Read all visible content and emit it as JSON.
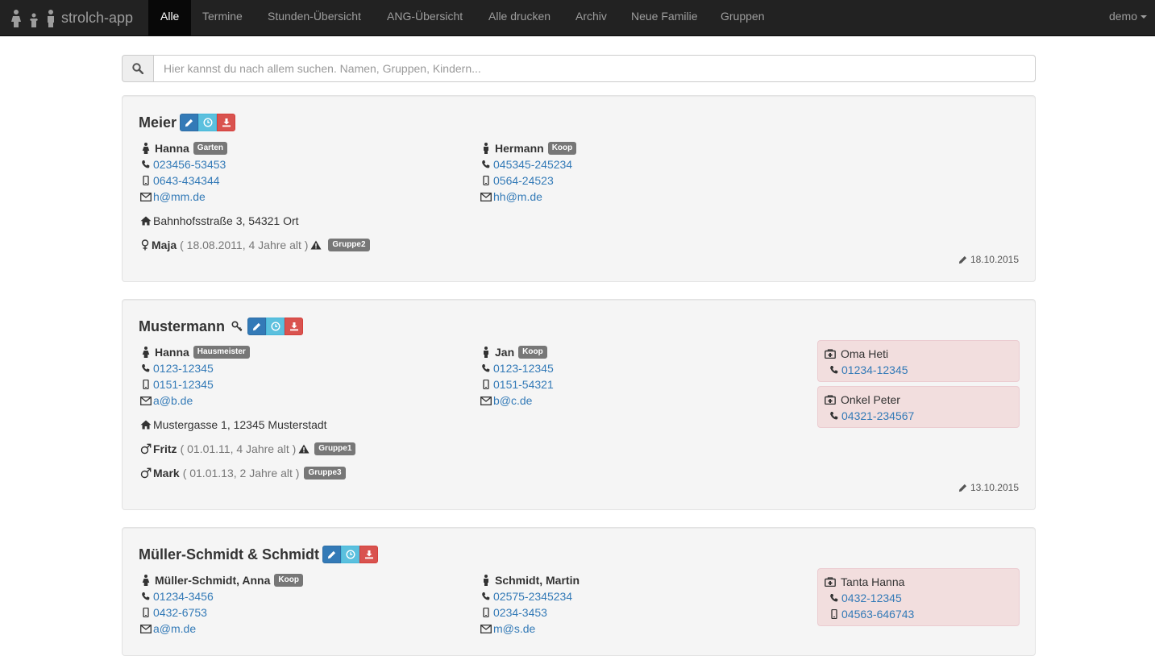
{
  "nav": {
    "brand": "strolch-app",
    "items": [
      {
        "label": "Alle",
        "active": true
      },
      {
        "label": "Termine"
      },
      {
        "label": "Stunden-Übersicht"
      },
      {
        "label": "ANG-Übersicht"
      },
      {
        "label": "Alle drucken"
      },
      {
        "label": "Archiv"
      },
      {
        "label": "Neue Familie"
      },
      {
        "label": "Gruppen"
      }
    ],
    "user": "demo"
  },
  "search": {
    "placeholder": "Hier kannst du nach allem suchen. Namen, Gruppen, Kindern..."
  },
  "families": [
    {
      "name": "Meier",
      "has_key": false,
      "parents": [
        {
          "gender": "female",
          "name": "Hanna",
          "role": "Garten",
          "phone": "023456-53453",
          "mobile": "0643-434344",
          "email": "h@mm.de"
        },
        {
          "gender": "male",
          "name": "Hermann",
          "role": "Koop",
          "phone": "045345-245234",
          "mobile": "0564-24523",
          "email": "hh@m.de"
        }
      ],
      "address": "Bahnhofsstraße 3, 54321 Ort",
      "children": [
        {
          "gender": "female",
          "name": "Maja",
          "meta": "( 18.08.2011, 4 Jahre alt )",
          "warning": true,
          "group": "Gruppe2"
        }
      ],
      "emergency": [],
      "updated": "18.10.2015"
    },
    {
      "name": "Mustermann",
      "has_key": true,
      "parents": [
        {
          "gender": "female",
          "name": "Hanna",
          "role": "Hausmeister",
          "phone": "0123-12345",
          "mobile": "0151-12345",
          "email": "a@b.de"
        },
        {
          "gender": "male",
          "name": "Jan",
          "role": "Koop",
          "phone": "0123-12345",
          "mobile": "0151-54321",
          "email": "b@c.de"
        }
      ],
      "address": "Mustergasse 1, 12345 Musterstadt",
      "children": [
        {
          "gender": "male",
          "name": "Fritz",
          "meta": "( 01.01.11, 4 Jahre alt )",
          "warning": true,
          "group": "Gruppe1"
        },
        {
          "gender": "male",
          "name": "Mark",
          "meta": "( 01.01.13, 2 Jahre alt )",
          "warning": false,
          "group": "Gruppe3"
        }
      ],
      "emergency": [
        {
          "name": "Oma Heti",
          "phone": "01234-12345"
        },
        {
          "name": "Onkel Peter",
          "phone": "04321-234567"
        }
      ],
      "updated": "13.10.2015"
    },
    {
      "name": "Müller-Schmidt & Schmidt",
      "has_key": false,
      "parents": [
        {
          "gender": "female",
          "name": "Müller-Schmidt, Anna",
          "role": "Koop",
          "phone": "01234-3456",
          "mobile": "0432-6753",
          "email": "a@m.de"
        },
        {
          "gender": "male",
          "name": "Schmidt, Martin",
          "role": "",
          "phone": "02575-2345234",
          "mobile": "0234-3453",
          "email": "m@s.de"
        }
      ],
      "emergency": [
        {
          "name": "Tanta Hanna",
          "phone": "0432-12345",
          "mobile": "04563-646743"
        }
      ]
    }
  ],
  "icons": {
    "search": "search-icon",
    "edit": "pencil-icon",
    "time": "clock-icon",
    "download": "download-icon",
    "key": "key-icon",
    "phone": "phone-icon",
    "mobile": "mobile-icon",
    "email": "envelope-icon",
    "home": "home-icon",
    "warning": "warning-icon",
    "emergency": "medkit-icon"
  },
  "colors": {
    "navbar": "#222222",
    "active": "#080808",
    "link": "#337ab7",
    "btn_edit": "#337ab7",
    "btn_time": "#5bc0de",
    "btn_download": "#d9534f",
    "label": "#777777",
    "card": "#f5f5f5",
    "emergency_box": "#f2dede"
  }
}
